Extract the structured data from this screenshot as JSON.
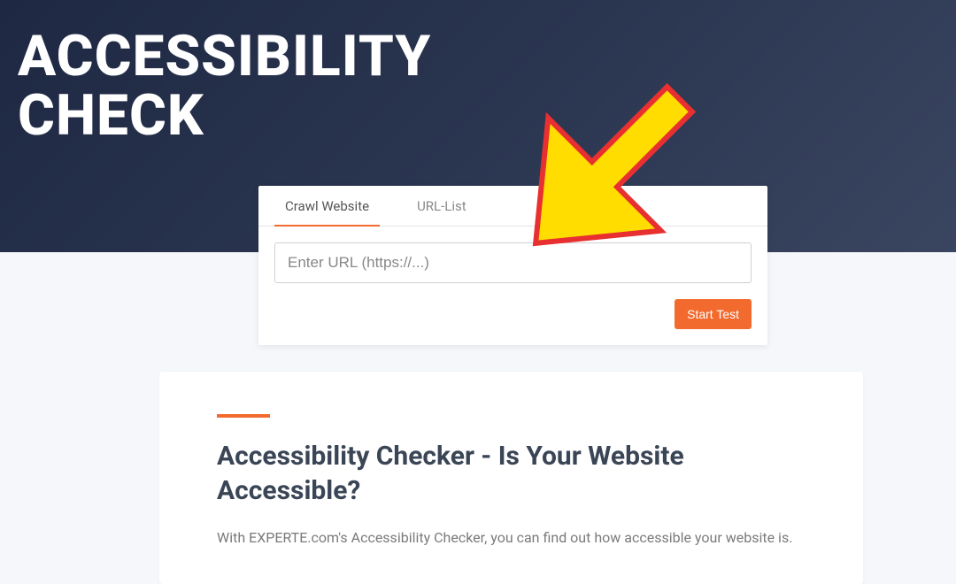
{
  "hero": {
    "title_line1": "ACCESSIBILITY",
    "title_line2": "CHECK"
  },
  "card": {
    "tabs": [
      {
        "label": "Crawl Website",
        "active": true
      },
      {
        "label": "URL-List",
        "active": false
      }
    ],
    "url_placeholder": "Enter URL (https://...)",
    "start_button": "Start Test"
  },
  "content": {
    "heading": "Accessibility Checker - Is Your Website Accessible?",
    "paragraph": "With EXPERTE.com's Accessibility Checker, you can find out how accessible your website is."
  },
  "overlay": {
    "arrow_name": "pointer-arrow-icon"
  }
}
